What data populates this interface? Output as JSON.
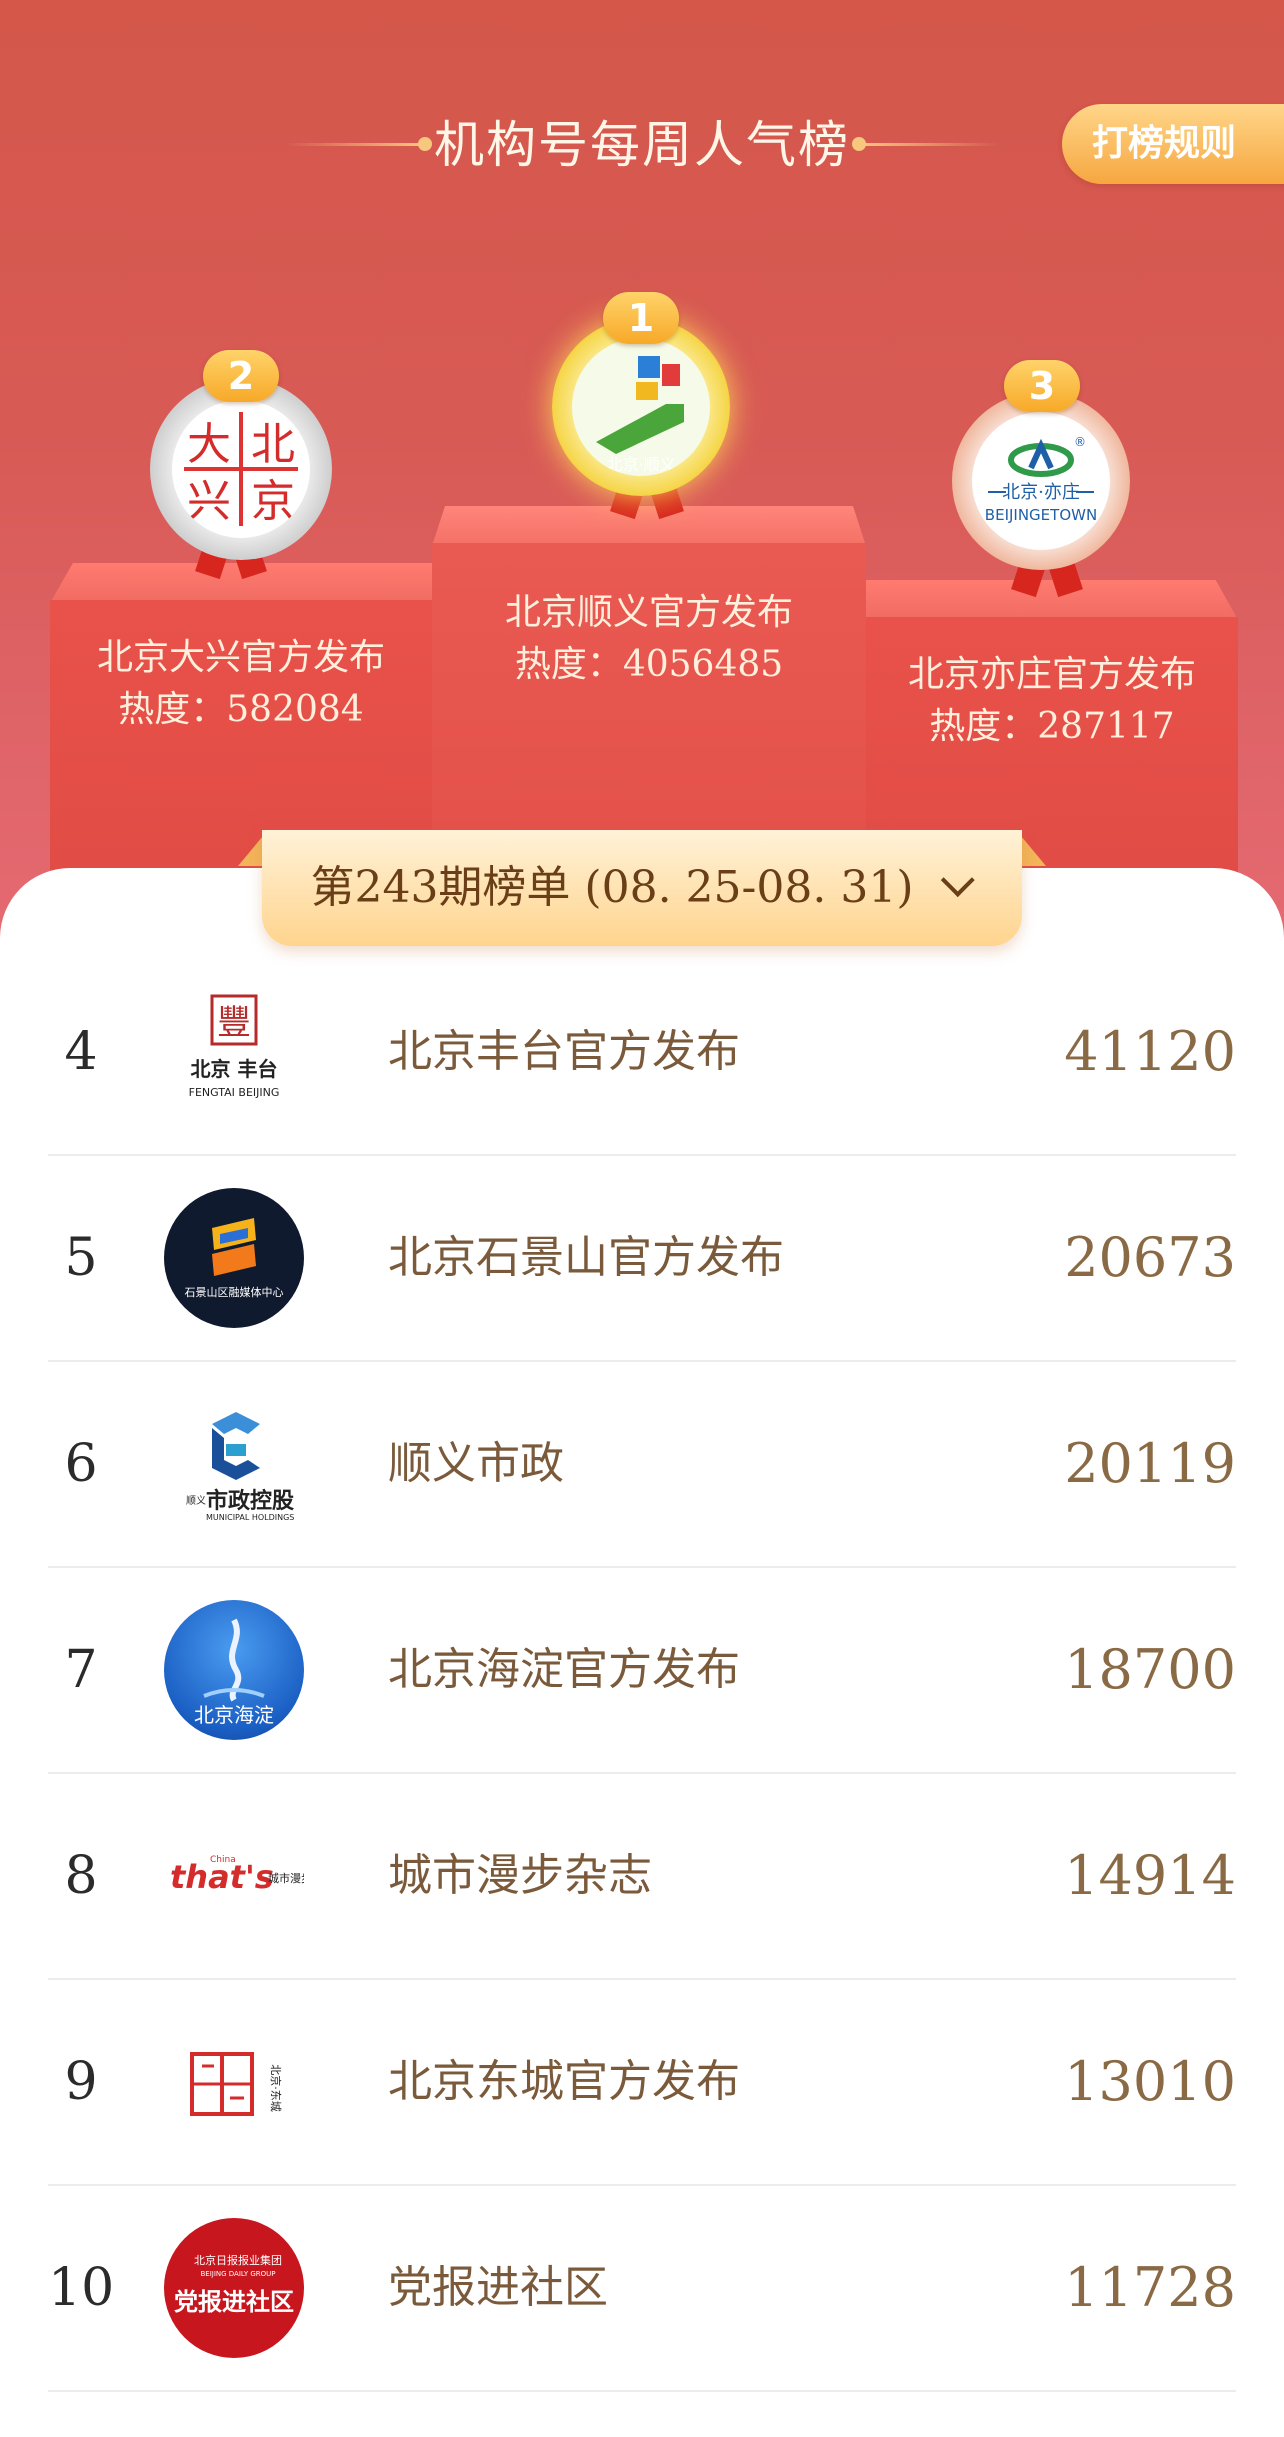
{
  "header": {
    "title": "机构号每周人气榜",
    "rules_button": "打榜规则"
  },
  "podium": [
    {
      "rank": "1",
      "name": "北京顺义官方发布",
      "heat_label": "热度：",
      "heat": "4056485",
      "logo_text": "北京·顺义",
      "medal": "gold"
    },
    {
      "rank": "2",
      "name": "北京大兴官方发布",
      "heat_label": "热度：",
      "heat": "582084",
      "logo_chars": [
        "大",
        "北",
        "兴",
        "京"
      ],
      "medal": "silver"
    },
    {
      "rank": "3",
      "name": "北京亦庄官方发布",
      "heat_label": "热度：",
      "heat": "287117",
      "logo_top": "北京·亦庄",
      "logo_bottom": "BEIJINGETOWN",
      "logo_reg": "®",
      "medal": "bronze"
    }
  ],
  "period": {
    "label": "第243期榜单 (08. 25-08. 31)"
  },
  "list": [
    {
      "rank": "4",
      "name": "北京丰台官方发布",
      "score": "41120",
      "logo": {
        "seal": "豐",
        "line1": "北京 丰台",
        "line2": "FENGTAI BEIJING"
      }
    },
    {
      "rank": "5",
      "name": "北京石景山官方发布",
      "score": "20673",
      "logo": {
        "line1": "石景山区融媒体中心"
      }
    },
    {
      "rank": "6",
      "name": "顺义市政",
      "score": "20119",
      "logo": {
        "prefix": "顺义",
        "line1": "市政控股",
        "line2": "MUNICIPAL HOLDINGS"
      }
    },
    {
      "rank": "7",
      "name": "北京海淀官方发布",
      "score": "18700",
      "logo": {
        "line1": "北京海淀"
      }
    },
    {
      "rank": "8",
      "name": "城市漫步杂志",
      "score": "14914",
      "logo": {
        "line1": "that's",
        "line2": "China",
        "line3": "城市漫步"
      }
    },
    {
      "rank": "9",
      "name": "北京东城官方发布",
      "score": "13010",
      "logo": {
        "line1": "北京·东城"
      }
    },
    {
      "rank": "10",
      "name": "党报进社区",
      "score": "11728",
      "logo": {
        "line1": "北京日报报业集团",
        "line2": "BEIJING DAILY GROUP",
        "line3": "党报进社区"
      }
    }
  ],
  "colors": {
    "hero_top": "#d4574a",
    "hero_bottom": "#e66a72",
    "podium_face": "#e04b45",
    "accent_gold": "#f7a928",
    "score_text": "#8a6a45",
    "name_text": "#7a5a3a"
  }
}
